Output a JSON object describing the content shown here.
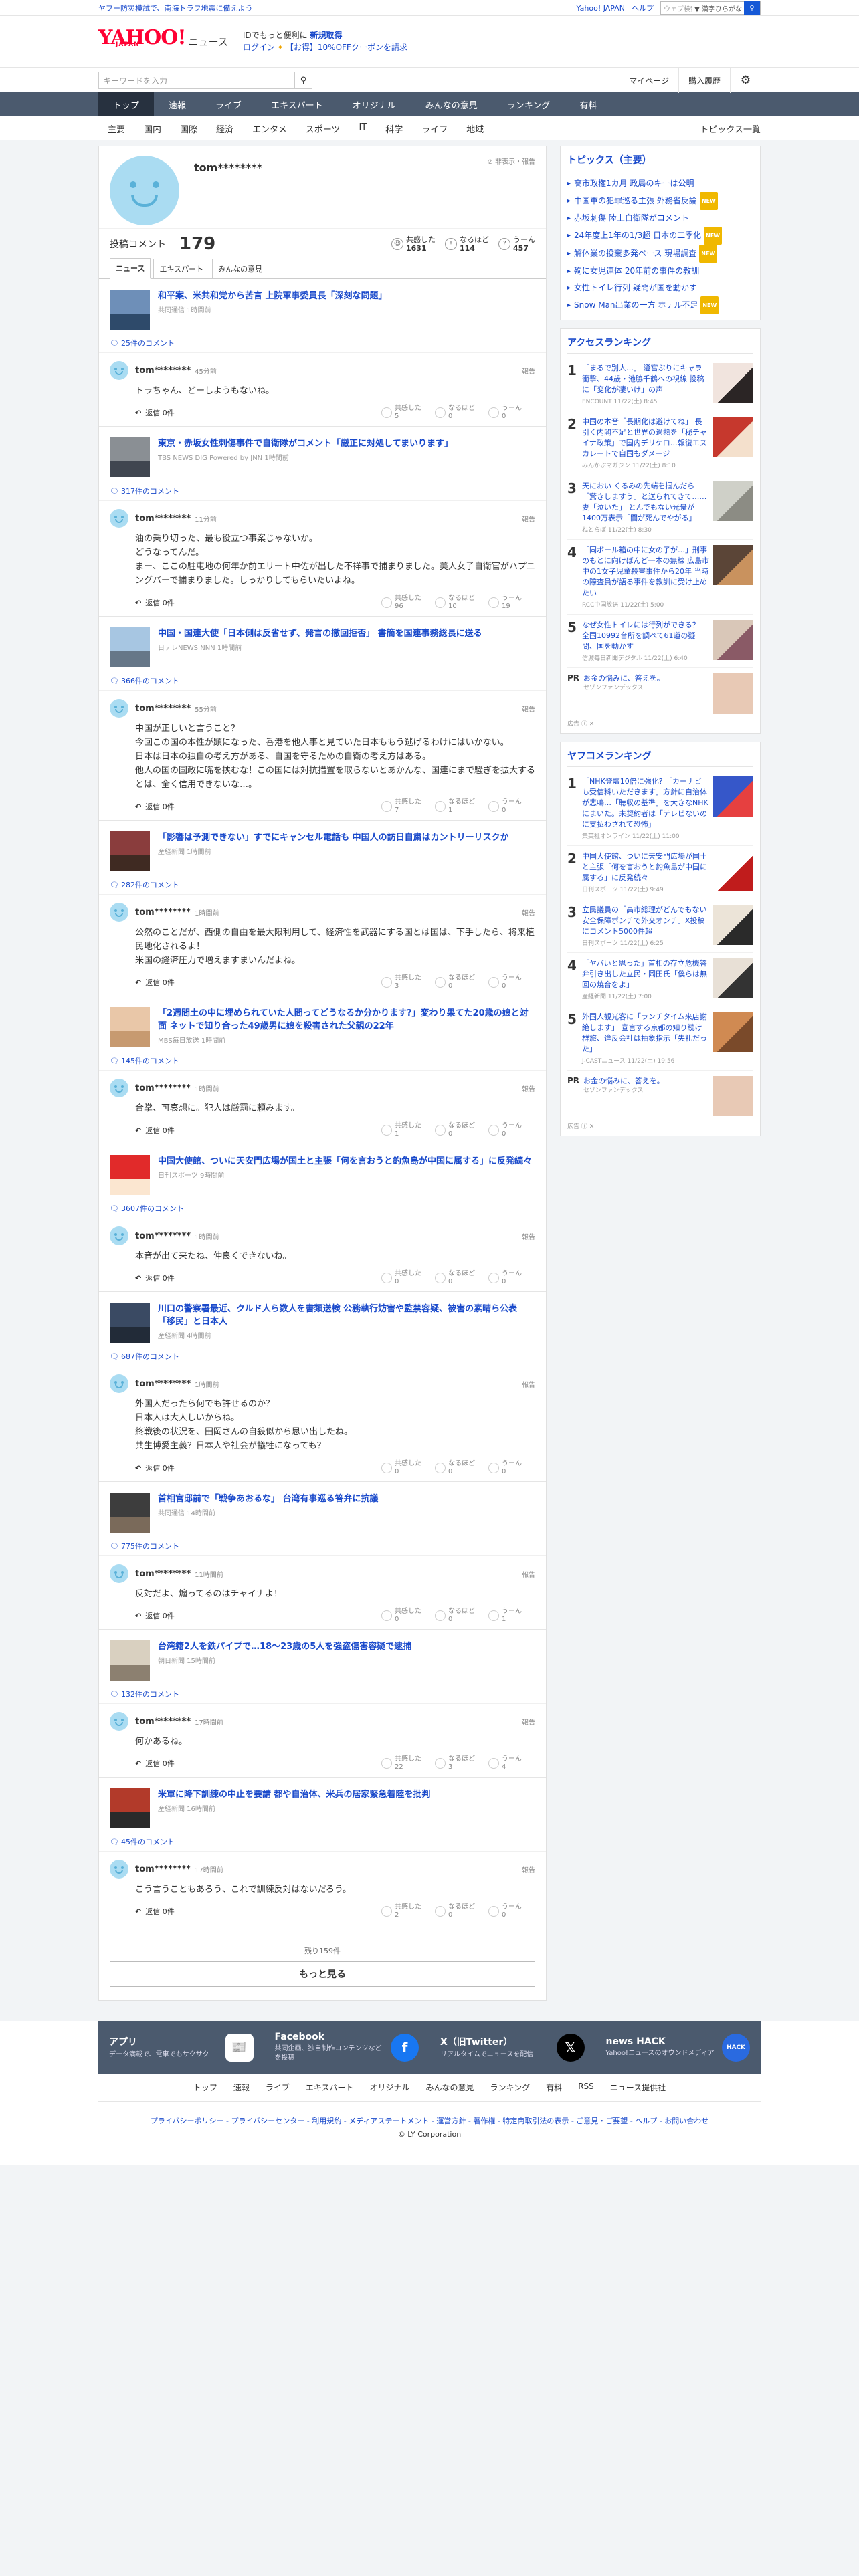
{
  "topbar": {
    "alert": "ヤフー防災模試で、南海トラフ地震に備えよう",
    "yj": "Yahoo! JAPAN",
    "help": "ヘルプ",
    "search_placeholder": "ウェブ検索",
    "search_mode": "▼ 漢字ひらがな"
  },
  "header": {
    "logo": "YAHOO!",
    "logo_sub": "JAPAN",
    "logo_news": "ニュース",
    "promo_line1": "IDでもっと便利に",
    "promo_line1_bold": "新規取得",
    "promo_login": "ログイン",
    "promo_coupon": "【お得】10%OFFクーポンを請求"
  },
  "util": {
    "search_placeholder": "キーワードを入力",
    "mypage": "マイページ",
    "history": "購入履歴"
  },
  "gnav": [
    "トップ",
    "速報",
    "ライブ",
    "エキスパート",
    "オリジナル",
    "みんなの意見",
    "ランキング",
    "有料"
  ],
  "subnav": [
    "主要",
    "国内",
    "国際",
    "経済",
    "エンタメ",
    "スポーツ",
    "IT",
    "科学",
    "ライフ",
    "地域"
  ],
  "subnav_all": "トピックス一覧",
  "profile": {
    "name": "tom********",
    "hide": "非表示・報告",
    "comment_label": "投稿コメント",
    "comment_count": "179",
    "rx": [
      {
        "label": "共感した",
        "value": "1631"
      },
      {
        "label": "なるほど",
        "value": "114"
      },
      {
        "label": "うーん",
        "value": "457"
      }
    ]
  },
  "tabs": [
    "ニュース",
    "エキスパート",
    "みんなの意見"
  ],
  "rx_labels": {
    "agree": "共感した",
    "hm": "なるほど",
    "uun": "うーん"
  },
  "report": "報告",
  "reply": "返信",
  "entries": [
    {
      "title": "和平案、米共和党から苦言 上院軍事委員長「深刻な問題」",
      "meta": "共同通信 1時間前",
      "ccount": "25件のコメント",
      "user": "tom********",
      "time": "45分前",
      "text": "トラちゃん、どーしようもないね。",
      "replies": "0件",
      "agree": "5",
      "hm": "0",
      "uun": "0"
    },
    {
      "title": "東京・赤坂女性刺傷事件で自衛隊がコメント「厳正に対処してまいります」",
      "meta": "TBS NEWS DIG Powered by JNN 1時間前",
      "ccount": "317件のコメント",
      "user": "tom********",
      "time": "11分前",
      "text": "油の乗り切った、最も役立つ事案じゃないか。\nどうなってんだ。\nまー、ここの駐屯地の何年か前エリート中佐が出した不祥事で捕まりました。美人女子自衛官がハプニングバーで捕まりました。しっかりしてもらいたいよね。",
      "replies": "0件",
      "agree": "96",
      "hm": "10",
      "uun": "19"
    },
    {
      "title": "中国・国連大使「日本側は反省せず、発言の撤回拒否」 書簡を国連事務総長に送る",
      "meta": "日テレNEWS NNN 1時間前",
      "ccount": "366件のコメント",
      "user": "tom********",
      "time": "55分前",
      "text": "中国が正しいと言うこと？\n今回この国の本性が顕になった、香港を他人事と見ていた日本ももう逃げるわけにはいかない。\n日本は日本の独自の考え方がある、自国を守るための自衛の考え方はある。\n他人の国の国政に嘴を挟むな！この国には対抗措置を取らないとあかんな、国連にまで騒ぎを拡大するとは、全く信用できないな…。",
      "replies": "0件",
      "agree": "7",
      "hm": "1",
      "uun": "0"
    },
    {
      "title": "「影響は予測できない」すでにキャンセル電話も 中国人の訪日自粛はカントリーリスクか",
      "meta": "産経新聞 1時間前",
      "ccount": "282件のコメント",
      "user": "tom********",
      "time": "1時間前",
      "text": "公然のことだが、西側の自由を最大限利用して、経済性を武器にする国とは国は、下手したら、将来植民地化されるよ！\n米国の経済圧力で増えますまいんだよね。",
      "replies": "0件",
      "agree": "3",
      "hm": "0",
      "uun": "0"
    },
    {
      "title": "「2週間土の中に埋められていた人間ってどうなるか分かります?」変わり果てた20歳の娘と対面 ネットで知り合った49歳男に娘を殺害された父親の22年",
      "meta": "MBS毎日放送 1時間前",
      "ccount": "145件のコメント",
      "user": "tom********",
      "time": "1時間前",
      "text": "合掌、可哀想に。犯人は厳罰に頼みます。",
      "replies": "0件",
      "agree": "1",
      "hm": "0",
      "uun": "0"
    },
    {
      "title": "中国大使館、ついに天安門広場が国土と主張「何を言おうと釣魚島が中国に属する」に反発続々",
      "meta": "日刊スポーツ 9時間前",
      "ccount": "3607件のコメント",
      "user": "tom********",
      "time": "1時間前",
      "text": "本音が出て来たね、仲良くできないね。",
      "replies": "0件",
      "agree": "0",
      "hm": "0",
      "uun": "0"
    },
    {
      "title": "川口の警察署最近、クルド人ら数人を書類送検 公務執行妨害や監禁容疑、被害の素晴ら公表 「移民」と日本人",
      "meta": "産経新聞 4時間前",
      "ccount": "687件のコメント",
      "user": "tom********",
      "time": "1時間前",
      "text": "外国人だったら何でも許せるのか？\n日本人は大人しいからね。\n終戦後の状況を、田岡さんの自殺似から思い出したね。\n共生博愛主義？日本人や社会が犠牲になっても？",
      "replies": "0件",
      "agree": "0",
      "hm": "0",
      "uun": "0"
    },
    {
      "title": "首相官邸前で「戦争あおるな」 台湾有事巡る答弁に抗議",
      "meta": "共同通信 14時間前",
      "ccount": "775件のコメント",
      "user": "tom********",
      "time": "11時間前",
      "text": "反対だよ、煽ってるのはチャイナよ！",
      "replies": "0件",
      "agree": "0",
      "hm": "0",
      "uun": "1"
    },
    {
      "title": "台湾籍2人を鉄パイプで…18〜23歳の5人を強盗傷害容疑で逮捕",
      "meta": "朝日新聞 15時間前",
      "ccount": "132件のコメント",
      "user": "tom********",
      "time": "17時間前",
      "text": "何かあるね。",
      "replies": "0件",
      "agree": "22",
      "hm": "3",
      "uun": "4"
    },
    {
      "title": "米軍に降下訓練の中止を要請 都や自治体、米兵の居家緊急着陸を批判",
      "meta": "産経新聞 16時間前",
      "ccount": "45件のコメント",
      "user": "tom********",
      "time": "17時間前",
      "text": "こう言うこともあろう、これで訓練反対はないだろう。",
      "replies": "0件",
      "agree": "2",
      "hm": "0",
      "uun": "0"
    }
  ],
  "remaining": "残り159件",
  "more": "もっと見る",
  "side": {
    "topics_title": "トピックス（主要）",
    "topics": [
      {
        "text": "高市政権1カ月 政局のキーは公明",
        "new": ""
      },
      {
        "text": "中国軍の犯罪巡る主張 外務省反論",
        "new": "NEW"
      },
      {
        "text": "赤坂刺傷 陸上自衛隊がコメント",
        "new": ""
      },
      {
        "text": "24年度上1年の1/3超 日本の二季化",
        "new": "NEW"
      },
      {
        "text": "解体業の投棄多発ペース 現場調査",
        "new": "NEW"
      },
      {
        "text": "殉に女児連体 20年前の事件の教訓",
        "new": ""
      },
      {
        "text": "女性トイレ行列 疑問が国を動かす",
        "new": ""
      },
      {
        "text": "Snow Man出業の一方 ホテル不足",
        "new": "NEW"
      }
    ],
    "access_title": "アクセスランキング",
    "access": [
      {
        "n": "1",
        "text": "「まるで別人…」 澄宮ぷりにキャラ衝撃、44歳・池脇千鶴への視線 投稿に「変化が凄いけ」の声",
        "meta": "ENCOUNT 11/22(土) 8:45"
      },
      {
        "n": "2",
        "text": "中国の本音「長期化は避けてね」 長引く内閣不足と世界の過熱を「秘チャイナ政策」で国内デリケロ…報復エスカレートで自国もダメージ",
        "meta": "みんかぶマガジン 11/22(土) 8:10"
      },
      {
        "n": "3",
        "text": "天におい くるみの先端を掴んだら「驚きしますう」と送られてきて……妻「泣いた」 とんでもない光景が1400万表示「闇が死んでやがる」",
        "meta": "ねとらぼ 11/22(土) 8:30"
      },
      {
        "n": "4",
        "text": "「同ボール箱の中に女の子が…」刑事のもとに向けばんど一本の無線 広島市中の1女子児童殺害事件から20年 当時の際査員が語る事件を教訓に受け止めたい",
        "meta": "RCC中国放送 11/22(土) 5:00"
      },
      {
        "n": "5",
        "text": "なぜ女性トイレには行列ができる？ 全国10992台所を調べて61道の疑問、国を動かす",
        "meta": "信濃毎日新聞デジタル 11/22(土) 6:40"
      }
    ],
    "pr1": {
      "label": "PR",
      "text": "お金の悩みに、答えを。",
      "sponsor": "セゾンファンデックス"
    },
    "ad_note": "広告 ⓘ ✕",
    "yahoo_title": "ヤフコメランキング",
    "yahoo": [
      {
        "n": "1",
        "text": "「NHK登壇10倍に強化? 「カーナビも受信料いただきます」方針に自治体が悲鳴…「聴収の基準」を大きなNHKにまいた。未契約者は「テレビないのに支払わされて恐怖」",
        "meta": "集英社オンライン 11/22(土) 11:00"
      },
      {
        "n": "2",
        "text": "中国大使館、ついに天安門広場が国土と主張「何を言おうと釣魚島が中国に属する」に反発続々",
        "meta": "日刊スポーツ 11/22(土) 9:49"
      },
      {
        "n": "3",
        "text": "立民議員の「高市総理がどんでもない安全保障ポンチで外交オンチ」X投稿にコメント5000件超",
        "meta": "日刊スポーツ 11/22(土) 6:25"
      },
      {
        "n": "4",
        "text": "「ヤバいと思った」首相の存立危機答弁引き出した立民・岡田氏「僕らは無回の焼合をよ」",
        "meta": "産経新聞 11/22(土) 7:00"
      },
      {
        "n": "5",
        "text": "外国人観光客に「ランチタイム来店謝絶します」 宣言する京都の知り続け群旅、違反会社は抽象指示「失礼だった」",
        "meta": "J-CASTニュース 11/22(土) 19:56"
      }
    ],
    "pr2": {
      "label": "PR",
      "text": "お金の悩みに、答えを。",
      "sponsor": "セゾンファンデックス"
    }
  },
  "footer": {
    "cells": [
      {
        "title": "アプリ",
        "desc": "データ満載で、電車でもサクサク",
        "icon": "📰"
      },
      {
        "title": "Facebook",
        "desc": "共同企画、独自制作コンテンツなどを投稿",
        "icon": "f"
      },
      {
        "title": "X（旧Twitter）",
        "desc": "リアルタイムでニュースを配信",
        "icon": "𝕏"
      },
      {
        "title": "news HACK",
        "desc": "Yahoo!ニュースのオウンドメディア",
        "icon": "HACK"
      }
    ],
    "nav": [
      "トップ",
      "速報",
      "ライブ",
      "エキスパート",
      "オリジナル",
      "みんなの意見",
      "ランキング",
      "有料",
      "RSS",
      "ニュース提供社"
    ],
    "legal": "プライバシーポリシー - プライバシーセンター - 利用規約 - メディアステートメント - 運営方針 - 著作権 - 特定商取引法の表示 - ご意見・ご要望 - ヘルプ - お問い合わせ",
    "copy": "© LY Corporation"
  }
}
